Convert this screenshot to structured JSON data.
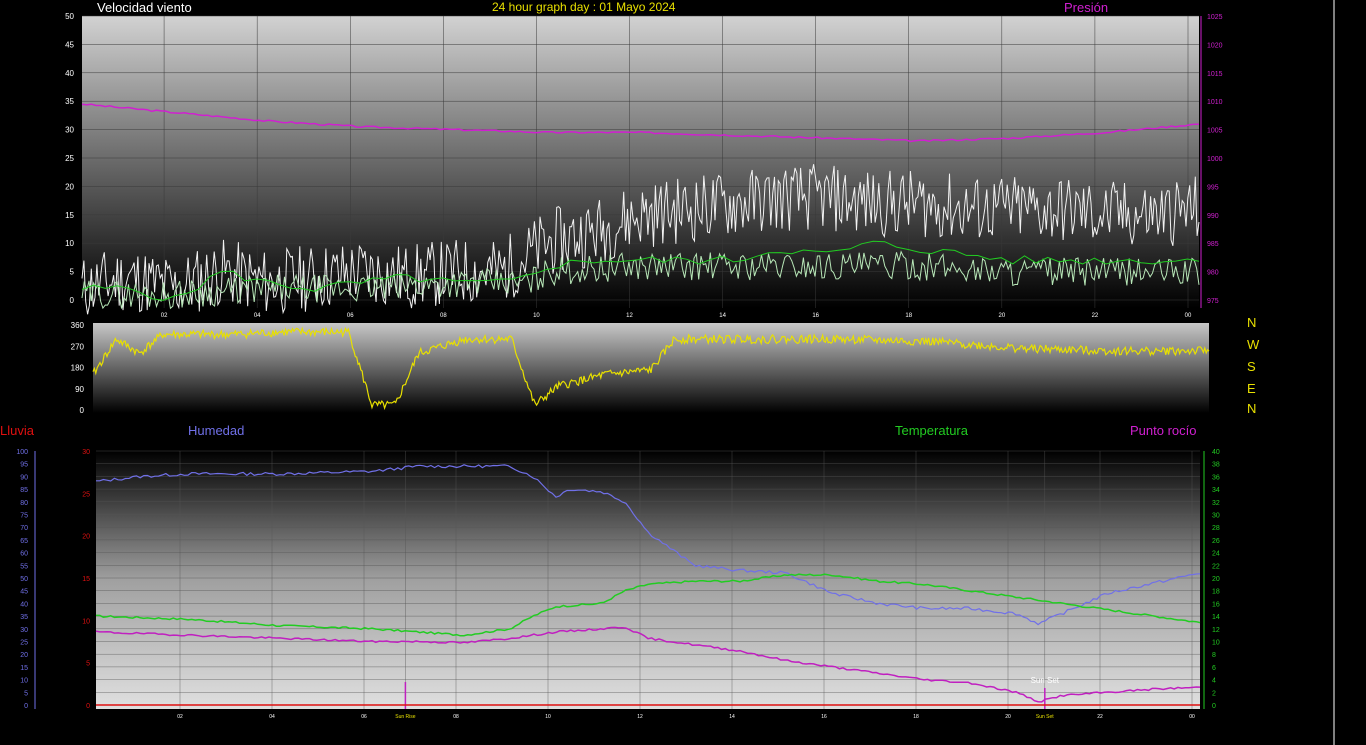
{
  "header": {
    "left_title": "Velocidad viento",
    "center_title": "24 hour graph day : 01 Mayo 2024",
    "right_title": "Presión"
  },
  "bottom_header": {
    "rain": "Lluvia",
    "humidity": "Humedad",
    "temperature": "Temperatura",
    "dewpoint": "Punto rocío"
  },
  "compass_letters": [
    "N",
    "W",
    "S",
    "E",
    "N"
  ],
  "colors": {
    "wind_gust": "#f2f2f2",
    "wind_avg": "#b8e8b8",
    "wind_dir_avg": "#22cc22",
    "pressure": "#d020d0",
    "direction": "#e8e000",
    "humidity": "#7070e8",
    "temperature": "#22cc22",
    "dewpoint": "#c020c0",
    "rain": "#e01010",
    "title_yellow": "#e8e000",
    "pressure_label": "#d020d0",
    "rain_label": "#e01010"
  },
  "chart_data": [
    {
      "type": "line",
      "name": "wind",
      "x_ticks": [
        "02",
        "04",
        "06",
        "08",
        "10",
        "12",
        "14",
        "16",
        "18",
        "20",
        "22",
        "00"
      ],
      "y_left_ticks": [
        "0",
        "5",
        "10",
        "15",
        "20",
        "25",
        "30",
        "35",
        "40",
        "45",
        "50"
      ],
      "y_left_range": [
        0,
        50
      ],
      "y_right_ticks": [
        "975",
        "980",
        "985",
        "990",
        "995",
        "1000",
        "1005",
        "1010",
        "1015",
        "1020",
        "1025"
      ],
      "y_right_range": [
        975,
        1025
      ],
      "x_range_hours": [
        0,
        24
      ],
      "grid": true,
      "series": [
        {
          "key": "pressure",
          "axis": "right",
          "points": [
            [
              0,
              1009.5
            ],
            [
              2,
              1008
            ],
            [
              4,
              1006.5
            ],
            [
              6,
              1005.5
            ],
            [
              8,
              1005
            ],
            [
              10,
              1004.5
            ],
            [
              12,
              1004.5
            ],
            [
              14,
              1004
            ],
            [
              16,
              1003.5
            ],
            [
              18,
              1003
            ],
            [
              20,
              1003.5
            ],
            [
              22,
              1004.5
            ],
            [
              24,
              1006
            ]
          ]
        },
        {
          "key": "wind_gust",
          "axis": "left",
          "points": [
            [
              0,
              2
            ],
            [
              1,
              4
            ],
            [
              2,
              2
            ],
            [
              3,
              5
            ],
            [
              4,
              3
            ],
            [
              5,
              4
            ],
            [
              6,
              5
            ],
            [
              7,
              4
            ],
            [
              8,
              5
            ],
            [
              9,
              5
            ],
            [
              9.6,
              8
            ],
            [
              10,
              10
            ],
            [
              11,
              12
            ],
            [
              12,
              15
            ],
            [
              13,
              16
            ],
            [
              14,
              17
            ],
            [
              15,
              18
            ],
            [
              16,
              18
            ],
            [
              17,
              17
            ],
            [
              18,
              17
            ],
            [
              19,
              16
            ],
            [
              20,
              16
            ],
            [
              21,
              16
            ],
            [
              22,
              15
            ],
            [
              23,
              15
            ],
            [
              24,
              16
            ]
          ]
        },
        {
          "key": "wind_avg",
          "axis": "left",
          "points": [
            [
              0,
              1
            ],
            [
              2,
              1
            ],
            [
              4,
              2
            ],
            [
              6,
              2
            ],
            [
              8,
              3
            ],
            [
              9.6,
              3
            ],
            [
              10,
              5
            ],
            [
              12,
              6
            ],
            [
              14,
              6
            ],
            [
              16,
              6
            ],
            [
              18,
              6
            ],
            [
              20,
              5
            ],
            [
              22,
              5
            ],
            [
              24,
              5
            ]
          ]
        },
        {
          "key": "wind_dir_avg",
          "axis": "left",
          "points": [
            [
              0,
              2
            ],
            [
              1,
              2
            ],
            [
              2,
              0
            ],
            [
              3,
              5
            ],
            [
              4,
              3
            ],
            [
              5,
              2
            ],
            [
              6,
              3
            ],
            [
              7,
              4
            ],
            [
              8,
              3
            ],
            [
              9,
              3
            ],
            [
              9.6,
              4
            ],
            [
              10,
              6
            ],
            [
              11,
              7
            ],
            [
              12,
              7
            ],
            [
              13,
              7
            ],
            [
              14,
              7
            ],
            [
              15,
              9
            ],
            [
              16,
              8
            ],
            [
              17,
              10
            ],
            [
              18,
              9
            ],
            [
              19,
              8
            ],
            [
              20,
              7
            ],
            [
              21,
              7
            ],
            [
              22,
              7
            ],
            [
              23,
              7
            ],
            [
              24,
              7
            ]
          ]
        }
      ]
    },
    {
      "type": "line",
      "name": "direction",
      "x_range_hours": [
        0,
        24
      ],
      "y_ticks": [
        "0",
        "90",
        "180",
        "270",
        "360"
      ],
      "y_range": [
        0,
        360
      ],
      "grid": false,
      "series": [
        {
          "key": "direction",
          "points": [
            [
              0,
              150
            ],
            [
              0.5,
              300
            ],
            [
              1,
              240
            ],
            [
              1.5,
              320
            ],
            [
              3,
              320
            ],
            [
              4,
              330
            ],
            [
              5,
              330
            ],
            [
              5.5,
              330
            ],
            [
              6,
              20
            ],
            [
              6.5,
              20
            ],
            [
              7,
              240
            ],
            [
              8,
              300
            ],
            [
              9,
              300
            ],
            [
              9.5,
              20
            ],
            [
              10,
              100
            ],
            [
              11,
              150
            ],
            [
              12,
              170
            ],
            [
              12.5,
              300
            ],
            [
              14,
              300
            ],
            [
              16,
              300
            ],
            [
              18,
              290
            ],
            [
              20,
              260
            ],
            [
              22,
              250
            ],
            [
              24,
              250
            ]
          ]
        }
      ]
    },
    {
      "type": "line",
      "name": "temp_humidity",
      "x_ticks": [
        "02",
        "04",
        "06",
        "Sun Rise",
        "08",
        "10",
        "12",
        "14",
        "16",
        "18",
        "20",
        "Sun Set",
        "22",
        "00"
      ],
      "y_far_left_ticks": [
        "0",
        "5",
        "10",
        "15",
        "20",
        "25",
        "30",
        "35",
        "40",
        "45",
        "50",
        "55",
        "60",
        "65",
        "70",
        "75",
        "80",
        "85",
        "90",
        "95",
        "100"
      ],
      "y_far_left_range": [
        0,
        100
      ],
      "y_left_ticks": [
        "0",
        "5",
        "10",
        "15",
        "20",
        "25",
        "30"
      ],
      "y_left_range": [
        0,
        30
      ],
      "y_right_ticks": [
        "0",
        "2",
        "4",
        "6",
        "8",
        "10",
        "12",
        "14",
        "16",
        "18",
        "20",
        "22",
        "24",
        "26",
        "28",
        "30",
        "32",
        "34",
        "36",
        "38",
        "40"
      ],
      "y_right_range": [
        0,
        40
      ],
      "x_range_hours": [
        0,
        24
      ],
      "annotations": [
        "Sun Set"
      ],
      "grid": true,
      "series": [
        {
          "key": "humidity",
          "axis": "far_left",
          "points": [
            [
              0,
              88
            ],
            [
              1,
              90
            ],
            [
              2,
              91
            ],
            [
              4,
              91
            ],
            [
              6,
              92
            ],
            [
              7,
              94
            ],
            [
              8,
              94
            ],
            [
              9,
              94
            ],
            [
              9.5,
              90
            ],
            [
              10,
              82
            ],
            [
              10.3,
              85
            ],
            [
              11,
              84
            ],
            [
              11.5,
              80
            ],
            [
              12,
              68
            ],
            [
              13,
              55
            ],
            [
              14,
              53
            ],
            [
              15,
              52
            ],
            [
              16,
              44
            ],
            [
              17,
              40
            ],
            [
              18,
              38
            ],
            [
              19,
              38
            ],
            [
              20,
              36
            ],
            [
              20.5,
              32
            ],
            [
              21,
              36
            ],
            [
              22,
              44
            ],
            [
              23,
              48
            ],
            [
              24,
              52
            ]
          ]
        },
        {
          "key": "temperature",
          "axis": "right",
          "points": [
            [
              0,
              14
            ],
            [
              2,
              13.5
            ],
            [
              4,
              12.5
            ],
            [
              6,
              12
            ],
            [
              7,
              11.5
            ],
            [
              8,
              11
            ],
            [
              9,
              12
            ],
            [
              9.5,
              14
            ],
            [
              10,
              15.5
            ],
            [
              11,
              16
            ],
            [
              11.5,
              18
            ],
            [
              12,
              19
            ],
            [
              13,
              19.5
            ],
            [
              14,
              19.5
            ],
            [
              15,
              20.5
            ],
            [
              16,
              20.5
            ],
            [
              17,
              19.5
            ],
            [
              18,
              19
            ],
            [
              19,
              18
            ],
            [
              20,
              17
            ],
            [
              21,
              16
            ],
            [
              22,
              15
            ],
            [
              23,
              14
            ],
            [
              24,
              13
            ]
          ]
        },
        {
          "key": "dewpoint",
          "axis": "right",
          "points": [
            [
              0,
              11.5
            ],
            [
              2,
              11
            ],
            [
              4,
              10.5
            ],
            [
              6,
              10
            ],
            [
              7,
              10
            ],
            [
              8,
              9.8
            ],
            [
              9,
              10.5
            ],
            [
              10,
              11.5
            ],
            [
              11,
              12
            ],
            [
              11.5,
              12.3
            ],
            [
              12,
              10.5
            ],
            [
              13,
              9.5
            ],
            [
              14,
              8.5
            ],
            [
              15,
              7
            ],
            [
              16,
              6
            ],
            [
              17,
              5
            ],
            [
              18,
              4
            ],
            [
              19,
              3.5
            ],
            [
              20,
              2
            ],
            [
              20.5,
              0.5
            ],
            [
              21,
              1.5
            ],
            [
              22,
              2
            ],
            [
              23,
              2.5
            ],
            [
              24,
              2.8
            ]
          ]
        },
        {
          "key": "rain",
          "axis": "left",
          "points": [
            [
              0,
              0
            ],
            [
              24,
              0
            ]
          ]
        }
      ]
    }
  ]
}
